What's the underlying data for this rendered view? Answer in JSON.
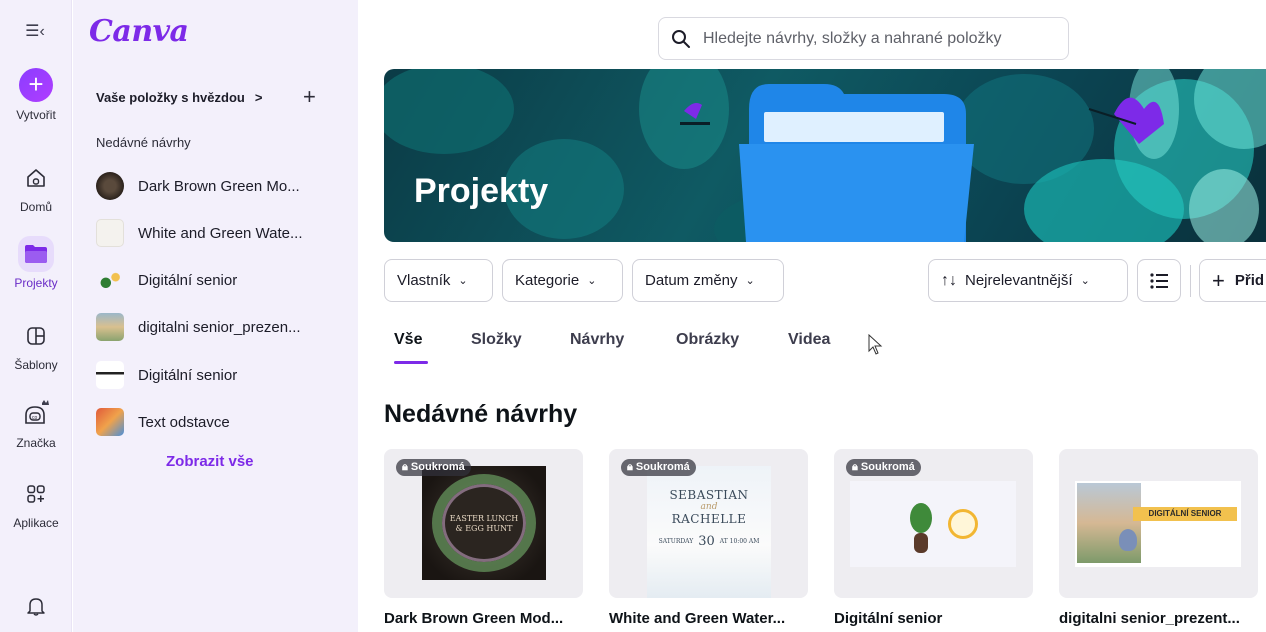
{
  "rail": {
    "items": [
      {
        "label": "Vytvořit",
        "icon": "plus-icon"
      },
      {
        "label": "Domů",
        "icon": "home-icon"
      },
      {
        "label": "Projekty",
        "icon": "folder-icon"
      },
      {
        "label": "Šablony",
        "icon": "templates-icon"
      },
      {
        "label": "Značka",
        "icon": "brand-icon"
      },
      {
        "label": "Aplikace",
        "icon": "apps-icon"
      }
    ]
  },
  "panel": {
    "logo": "Canva",
    "starred_label": "Vaše položky s hvězdou",
    "starred_chevron": ">",
    "add": "+",
    "recent_heading": "Nedávné návrhy",
    "recent": [
      {
        "name": "Dark Brown Green Mo..."
      },
      {
        "name": "White and Green Wate..."
      },
      {
        "name": "Digitální senior"
      },
      {
        "name": "digitalni senior_prezen..."
      },
      {
        "name": "Digitální senior"
      },
      {
        "name": "Text odstavce"
      }
    ],
    "show_all": "Zobrazit vše"
  },
  "search": {
    "placeholder": "Hledejte návrhy, složky a nahrané položky"
  },
  "hero": {
    "title": "Projekty"
  },
  "filters": {
    "owner": "Vlastník",
    "category": "Kategorie",
    "date": "Datum změny",
    "sort": "Nejrelevantnější",
    "add": "Přid"
  },
  "tabs": [
    "Vše",
    "Složky",
    "Návrhy",
    "Obrázky",
    "Videa"
  ],
  "section_title": "Nedávné návrhy",
  "cards": [
    {
      "badge": "Soukromá",
      "name": "Dark Brown Green Mod..."
    },
    {
      "badge": "Soukromá",
      "name": "White and Green Water..."
    },
    {
      "badge": "Soukromá",
      "name": "Digitální senior"
    },
    {
      "badge": "",
      "name": "digitalni senior_prezent..."
    }
  ],
  "thumb_texts": {
    "card1": [
      "EASTER LUNCH",
      "& EGG HUNT"
    ],
    "card2": [
      "SEBASTIAN",
      "and",
      "RACHELLE",
      "SATURDAY",
      "30",
      "AT 10:00 AM"
    ],
    "card4": "DIGITÁLNÍ SENIOR"
  },
  "colors": {
    "accent": "#7d2ae8",
    "rail_bg": "#f3f0fb"
  }
}
